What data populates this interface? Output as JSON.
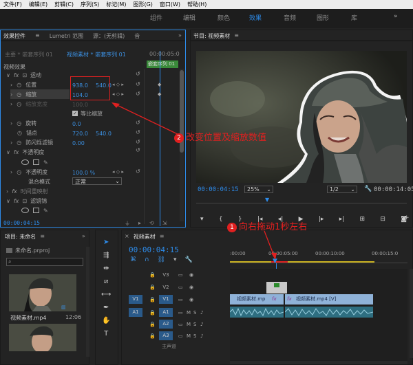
{
  "menu": [
    "文件(F)",
    "编辑(E)",
    "剪辑(C)",
    "序列(S)",
    "标记(M)",
    "图形(G)",
    "窗口(W)",
    "帮助(H)"
  ],
  "workspaces": [
    "组件",
    "编辑",
    "颜色",
    "效果",
    "音频",
    "图形",
    "库"
  ],
  "workspace_active": "效果",
  "effect_controls": {
    "tab_label": "效果控件",
    "tab2": "Lumetri 范围",
    "tab3": "源：(无剪辑)",
    "tab4": "音",
    "clip_path": "主要 * 嵌套序列 01",
    "sequence_path": "视频素材 * 嵌套序列 01",
    "time_ruler": "00:00:05:0",
    "clip_label": "嵌套序列 01",
    "section_video": "视频效果",
    "motion": "运动",
    "position_label": "位置",
    "position_x": "938.0",
    "position_y": "540.0",
    "scale_label": "缩放",
    "scale_value": "104.0",
    "scale_width_label": "缩放宽度",
    "scale_width_value": "100.0",
    "uniform_scale": "等比缩放",
    "rotation_label": "旋转",
    "rotation_value": "0.0",
    "anchor_label": "锚点",
    "anchor_x": "720.0",
    "anchor_y": "540.0",
    "flicker_label": "防闪烁滤镜",
    "flicker_value": "0.00",
    "opacity_section": "不透明度",
    "opacity_label": "不透明度",
    "opacity_value": "100.0 %",
    "blend_label": "混合模式",
    "blend_value": "正常",
    "time_remap": "时间重映射",
    "extra_effect": "滤镜锦",
    "timecode": "00:00:04:15"
  },
  "program": {
    "title": "节目: 视频素材",
    "timecode": "00:00:04:15",
    "zoom": "25%",
    "resolution": "1/2",
    "duration": "00:00:14:05"
  },
  "project": {
    "title": "项目: 未命名",
    "file": "未命名.prproj",
    "clip_name": "视频素材.mp4",
    "clip_duration": "12:06"
  },
  "timeline": {
    "title": "视频素材",
    "timecode": "00:00:04:15",
    "ruler": [
      ":00:00",
      "00:00:05:00",
      "00:00:10:00",
      "00:00:15:0"
    ],
    "tracks_video": [
      "V3",
      "V2",
      "V1"
    ],
    "tracks_audio": [
      "A1",
      "A2",
      "A3"
    ],
    "master": "主声道",
    "clip1_name": "视频素材.mp",
    "clip2_name": "视频素材.mp4 [V]",
    "fx_label": "fx"
  },
  "annotations": {
    "step1_num": "1",
    "step1_text": "向右拖动1秒左右",
    "step2_num": "2",
    "step2_text": "改变位置及缩放数值"
  },
  "colors": {
    "accent": "#2d8ceb",
    "annotation": "#e02020",
    "clip_video": "#8fb2d8",
    "clip_audio": "#2e6e80"
  }
}
